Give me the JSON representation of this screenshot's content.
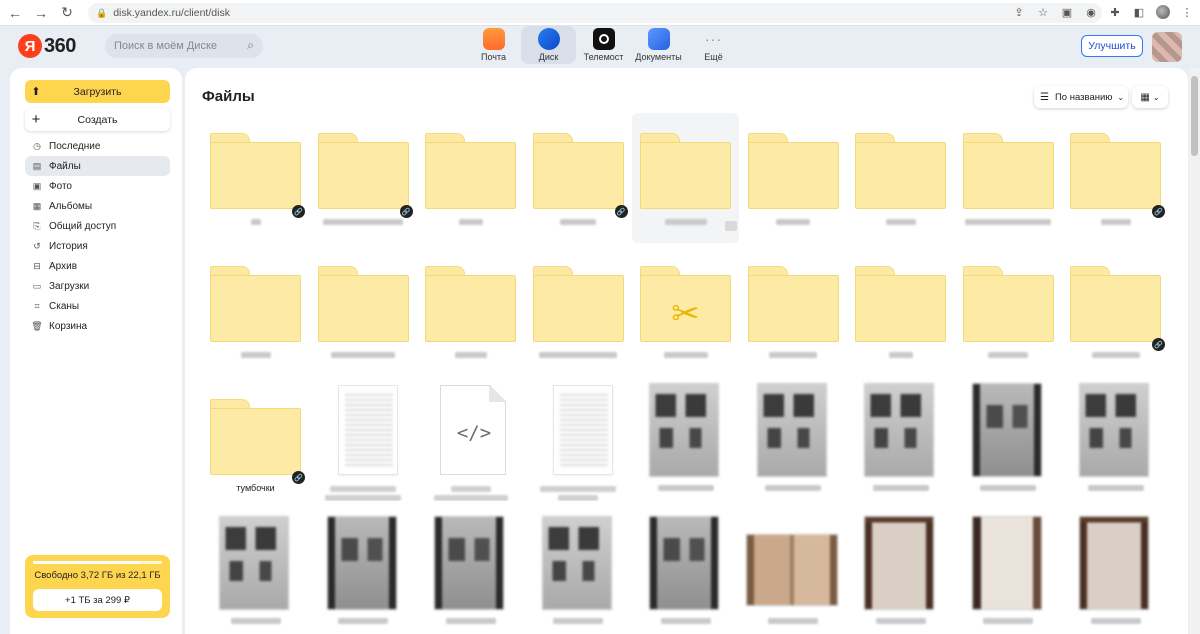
{
  "browser": {
    "url": "disk.yandex.ru/client/disk"
  },
  "header": {
    "logo_ya": "Я",
    "logo_360": "360",
    "search_placeholder": "Поиск в моём Диске",
    "apps": [
      {
        "label": "Почта",
        "icon": "mail-icon"
      },
      {
        "label": "Диск",
        "icon": "disk-icon",
        "active": true
      },
      {
        "label": "Телемост",
        "icon": "telemost-icon"
      },
      {
        "label": "Документы",
        "icon": "documents-icon"
      },
      {
        "label": "Ещё",
        "icon": "more-icon"
      }
    ],
    "upgrade_label": "Улучшить"
  },
  "sidebar": {
    "upload_label": "Загрузить",
    "create_label": "Создать",
    "items": [
      {
        "label": "Последние",
        "icon": "clock-icon"
      },
      {
        "label": "Файлы",
        "icon": "file-icon",
        "active": true
      },
      {
        "label": "Фото",
        "icon": "photo-icon"
      },
      {
        "label": "Альбомы",
        "icon": "albums-icon"
      },
      {
        "label": "Общий доступ",
        "icon": "shared-icon"
      },
      {
        "label": "История",
        "icon": "history-icon"
      },
      {
        "label": "Архив",
        "icon": "archive-icon"
      },
      {
        "label": "Загрузки",
        "icon": "downloads-icon"
      },
      {
        "label": "Сканы",
        "icon": "scan-icon"
      },
      {
        "label": "Корзина",
        "icon": "trash-icon"
      }
    ],
    "storage": {
      "free_text": "Свободно 3,72 ГБ из 22,1 ГБ",
      "used_fraction": 0.83,
      "buy_label": "+1 ТБ за 299 ₽"
    }
  },
  "main": {
    "title": "Файлы",
    "sort_label": "По названию",
    "visible_named_folder": "тумбочки"
  },
  "colors": {
    "accent_yellow": "#fed54f",
    "folder_fill": "#fdeaa5",
    "upgrade_blue": "#3377ff",
    "yandex_red": "#fc3f1d"
  }
}
